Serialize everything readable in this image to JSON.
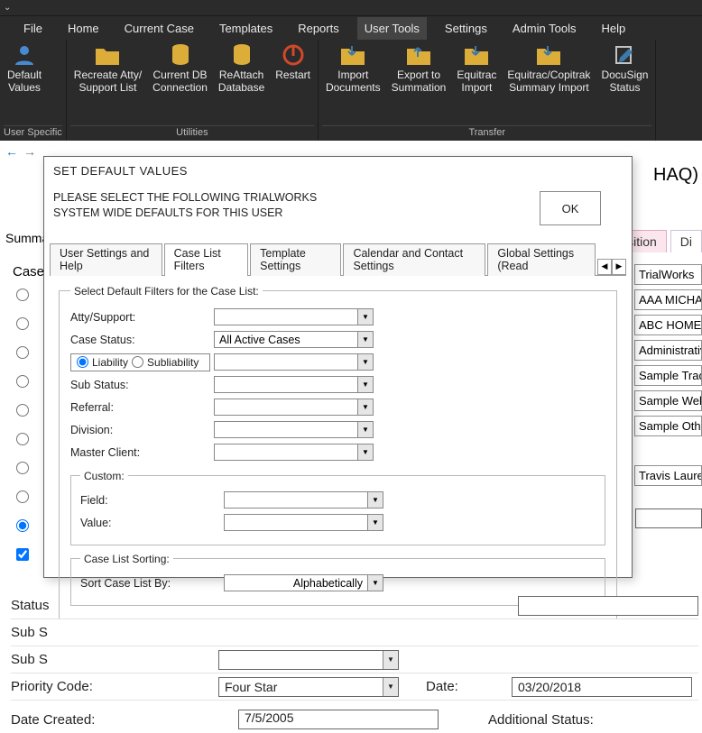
{
  "titlebar": {
    "sym": "⌄"
  },
  "menu": {
    "items": [
      "File",
      "Home",
      "Current Case",
      "Templates",
      "Reports",
      "User Tools",
      "Settings",
      "Admin Tools",
      "Help"
    ],
    "active": 5
  },
  "ribbon": {
    "groups": [
      {
        "label": "User Specific",
        "buttons": [
          {
            "name": "default-values",
            "lines": [
              "Default",
              "Values"
            ],
            "icon": "user"
          }
        ]
      },
      {
        "label": "Utilities",
        "buttons": [
          {
            "name": "recreate-atty",
            "lines": [
              "Recreate Atty/",
              "Support List"
            ],
            "icon": "folder"
          },
          {
            "name": "current-db",
            "lines": [
              "Current DB",
              "Connection"
            ],
            "icon": "db"
          },
          {
            "name": "reattach-db",
            "lines": [
              "ReAttach",
              "Database"
            ],
            "icon": "db"
          },
          {
            "name": "restart",
            "lines": [
              "Restart"
            ],
            "icon": "power"
          }
        ]
      },
      {
        "label": "Transfer",
        "buttons": [
          {
            "name": "import-docs",
            "lines": [
              "Import",
              "Documents"
            ],
            "icon": "folder-in"
          },
          {
            "name": "export-summation",
            "lines": [
              "Export to",
              "Summation"
            ],
            "icon": "folder-out"
          },
          {
            "name": "equitrac-import",
            "lines": [
              "Equitrac",
              "Import"
            ],
            "icon": "folder-in"
          },
          {
            "name": "equitrac-summary",
            "lines": [
              "Equitrac/Copitrak",
              "Summary Import"
            ],
            "icon": "folder-in"
          },
          {
            "name": "docusign",
            "lines": [
              "DocuSign",
              "Status"
            ],
            "icon": "pen"
          }
        ]
      }
    ]
  },
  "bg": {
    "title_suffix": "HAQ)",
    "left_text": "Summa",
    "tabs": [
      "Deposition",
      "Di"
    ],
    "side": [
      "TrialWorks",
      "AAA MICHAE",
      "ABC HOMEC",
      "Administrativ",
      "Sample Trad",
      "Sample Web",
      "Sample Othe",
      "",
      "Travis Lauren"
    ],
    "case_label": "Case"
  },
  "dialog": {
    "title": "SET DEFAULT VALUES",
    "instr1": "PLEASE SELECT THE FOLLOWING TRIALWORKS",
    "instr2": "SYSTEM WIDE DEFAULTS FOR THIS USER",
    "ok": "OK",
    "tabs": [
      "User Settings and Help",
      "Case List Filters",
      "Template Settings",
      "Calendar and Contact Settings",
      "Global Settings (Read"
    ],
    "active_tab": 1,
    "filters": {
      "legend": "Select Default Filters for the Case List:",
      "atty": "Atty/Support:",
      "case_status": "Case Status:",
      "case_status_val": "All Active Cases",
      "liability": "Liability",
      "subliability": "Subliability",
      "sub_status": "Sub Status:",
      "referral": "Referral:",
      "division": "Division:",
      "master_client": "Master Client:",
      "custom": "Custom:",
      "field": "Field:",
      "value": "Value:",
      "sorting": "Case List Sorting:",
      "sort_by": "Sort Case List By:",
      "sort_val": "Alphabetically"
    }
  },
  "bottom": {
    "status": "Status",
    "subs1": "Sub S",
    "subs2": "Sub S",
    "priority": "Priority Code:",
    "priority_val": "Four Star",
    "date_lbl": "Date:",
    "date_val": "03/20/2018",
    "datecreated": "Date Created:",
    "datecreated_val": "7/5/2005",
    "addstatus": "Additional Status:"
  }
}
